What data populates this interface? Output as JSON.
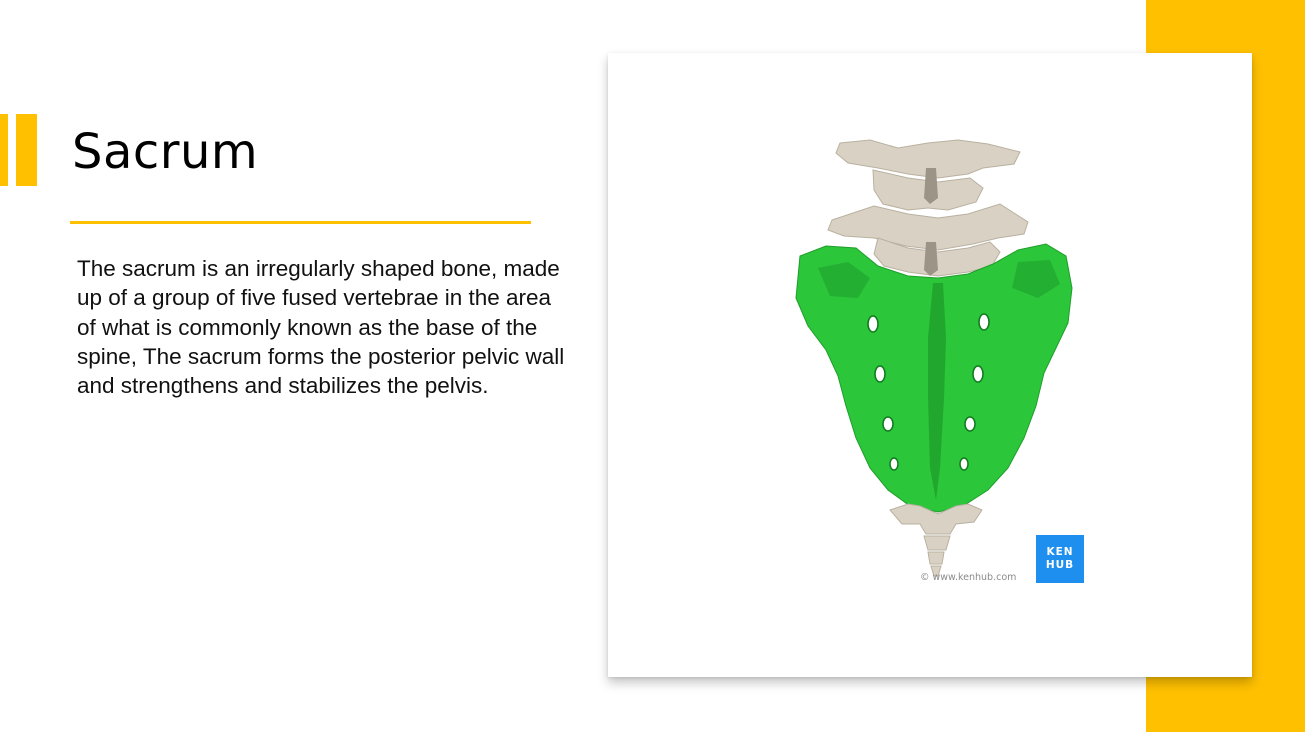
{
  "slide": {
    "title": "Sacrum",
    "body": "The sacrum is an irregularly shaped bone, made up of a group of five fused vertebrae in the area of what is commonly known as the base of the spine, The sacrum forms the posterior pelvic wall and strengthens and stabilizes the pelvis."
  },
  "image": {
    "logo_line1": "KEN",
    "logo_line2": "HUB",
    "copyright": "© www.kenhub.com"
  },
  "colors": {
    "accent": "#FFC000",
    "sacrum_green": "#2BC63A",
    "bone": "#D9D2C4",
    "kenhub_blue": "#1E8FEF"
  }
}
